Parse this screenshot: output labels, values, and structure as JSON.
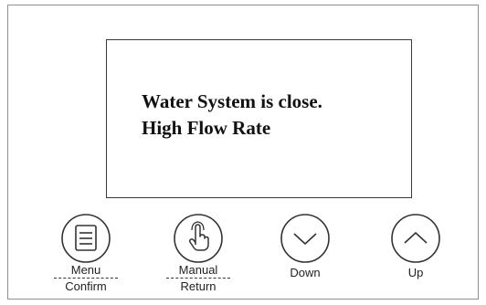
{
  "display": {
    "line1": "Water System is close.",
    "line2": "High Flow Rate"
  },
  "buttons": {
    "menu": {
      "icon": "menu-list-icon",
      "label_top": "Menu",
      "label_bottom": "Confirm"
    },
    "manual": {
      "icon": "hand-pointer-icon",
      "label_top": "Manual",
      "label_bottom": "Return"
    },
    "down": {
      "icon": "chevron-down-icon",
      "label": "Down"
    },
    "up": {
      "icon": "chevron-up-icon",
      "label": "Up"
    }
  }
}
